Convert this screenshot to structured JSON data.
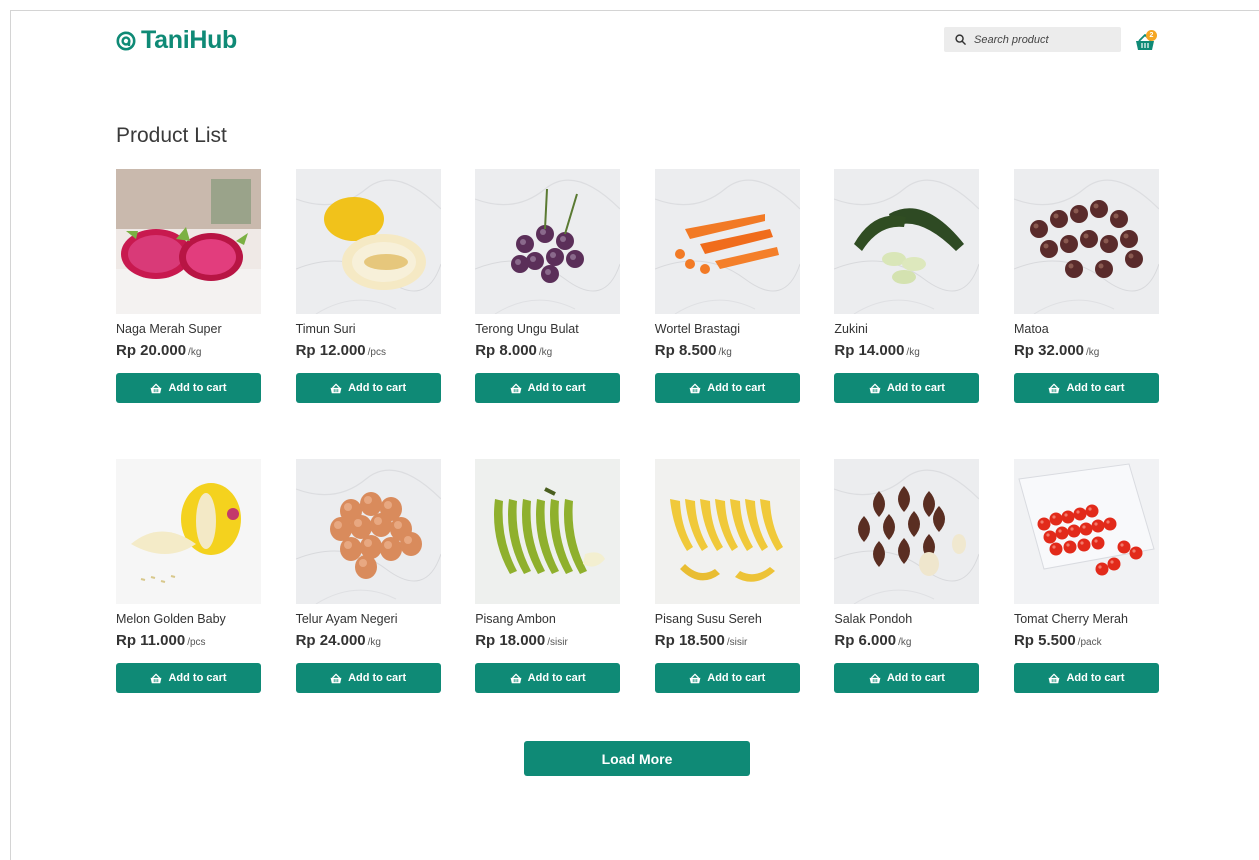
{
  "header": {
    "logo_text": "TaniHub",
    "search_placeholder": "Search product",
    "cart_count": "2",
    "brand_color": "#0f8a76",
    "badge_color": "#f5a623"
  },
  "page": {
    "title": "Product List",
    "load_more_label": "Load More",
    "add_to_cart_label": "Add to cart"
  },
  "products": [
    {
      "name": "Naga Merah Super",
      "price": "Rp 20.000",
      "unit": "/kg",
      "image": "dragon-fruit"
    },
    {
      "name": "Timun Suri",
      "price": "Rp 12.000",
      "unit": "/pcs",
      "image": "timun-suri"
    },
    {
      "name": "Terong Ungu Bulat",
      "price": "Rp 8.000",
      "unit": "/kg",
      "image": "round-eggplant"
    },
    {
      "name": "Wortel Brastagi",
      "price": "Rp 8.500",
      "unit": "/kg",
      "image": "carrot"
    },
    {
      "name": "Zukini",
      "price": "Rp 14.000",
      "unit": "/kg",
      "image": "zucchini"
    },
    {
      "name": "Matoa",
      "price": "Rp 32.000",
      "unit": "/kg",
      "image": "matoa"
    },
    {
      "name": "Melon Golden Baby",
      "price": "Rp 11.000",
      "unit": "/pcs",
      "image": "golden-melon"
    },
    {
      "name": "Telur Ayam Negeri",
      "price": "Rp 24.000",
      "unit": "/kg",
      "image": "eggs"
    },
    {
      "name": "Pisang Ambon",
      "price": "Rp 18.000",
      "unit": "/sisir",
      "image": "ambon-banana"
    },
    {
      "name": "Pisang Susu Sereh",
      "price": "Rp 18.500",
      "unit": "/sisir",
      "image": "susu-banana"
    },
    {
      "name": "Salak Pondoh",
      "price": "Rp 6.000",
      "unit": "/kg",
      "image": "salak"
    },
    {
      "name": "Tomat Cherry Merah",
      "price": "Rp 5.500",
      "unit": "/pack",
      "image": "cherry-tomato"
    }
  ]
}
